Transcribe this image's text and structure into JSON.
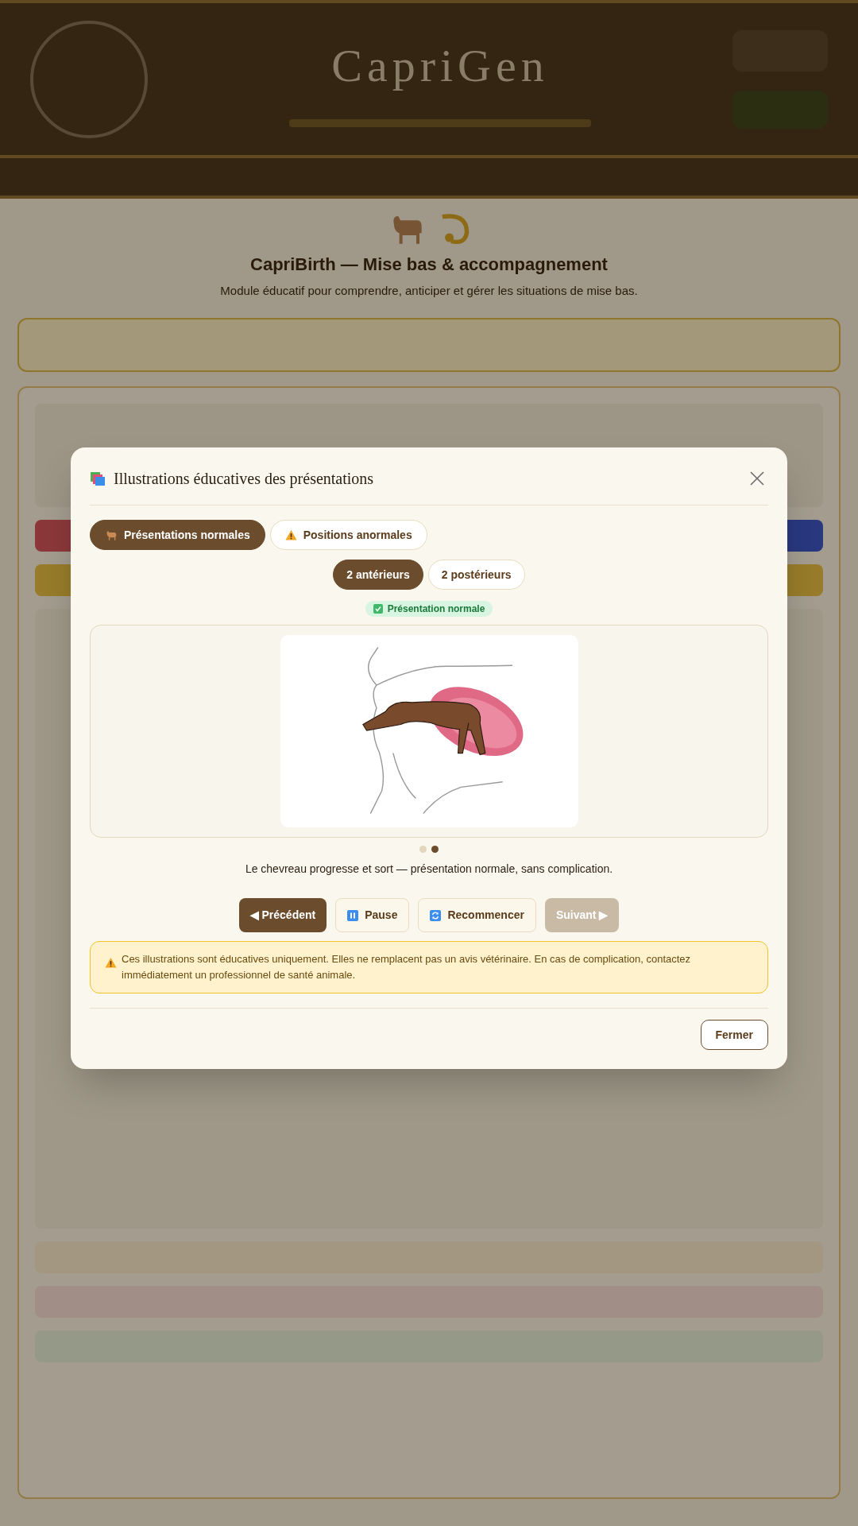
{
  "app": {
    "title": "CapriGen"
  },
  "page": {
    "title": "CapriBirth — Mise bas & accompagnement",
    "subtitle": "Module éducatif pour comprendre, anticiper et gérer les situations de mise bas."
  },
  "modal": {
    "title": "Illustrations éducatives des présentations",
    "tabs": [
      {
        "label": "Présentations normales",
        "selected": true,
        "kind": "goat"
      },
      {
        "label": "Positions anormales",
        "selected": false,
        "kind": "warning"
      }
    ],
    "subtabs": [
      {
        "label": "2 antérieurs",
        "selected": true
      },
      {
        "label": "2 postérieurs",
        "selected": false
      }
    ],
    "badge": "Présentation normale",
    "steps": [
      {
        "selected": false
      },
      {
        "selected": true
      }
    ],
    "caption": "Le chevreau progresse et sort — présentation normale, sans complication.",
    "controls": [
      {
        "label": "◀ Précédent",
        "kind": "primary",
        "disabled": false
      },
      {
        "label": "Pause",
        "kind": "pause",
        "disabled": false
      },
      {
        "label": "Recommencer",
        "kind": "restart",
        "disabled": false
      },
      {
        "label": "Suivant ▶",
        "kind": "primary",
        "disabled": true
      }
    ],
    "warning": "Ces illustrations sont éducatives uniquement. Elles ne remplacent pas un avis vétérinaire. En cas de complication, contactez immédiatement un professionnel de santé animale.",
    "close_button": "Fermer"
  }
}
